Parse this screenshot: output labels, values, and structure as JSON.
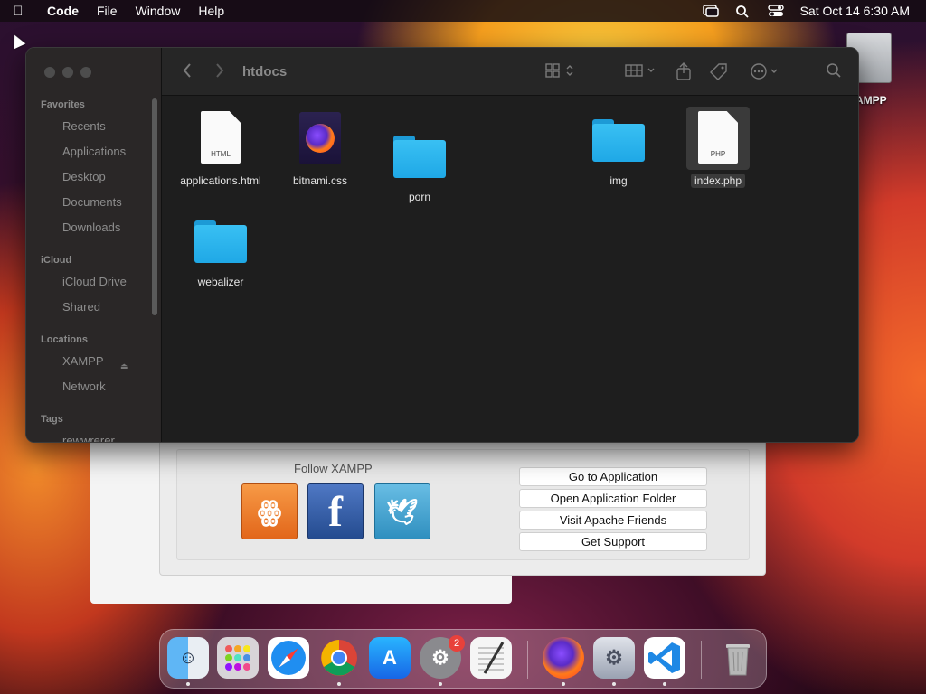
{
  "menubar": {
    "apple_icon": "apple-logo-icon",
    "app_name": "Code",
    "items": [
      "File",
      "Window",
      "Help"
    ],
    "status_icons": [
      "screen-mirroring-icon",
      "search-icon",
      "control-center-icon"
    ],
    "clock": "Sat Oct 14  6:30 AM"
  },
  "desktop": {
    "disk_label": "XAMPP"
  },
  "finder": {
    "title": "htdocs",
    "sidebar": {
      "favorites_heading": "Favorites",
      "favorites": [
        "Recents",
        "Applications",
        "Desktop",
        "Documents",
        "Downloads"
      ],
      "icloud_heading": "iCloud",
      "icloud": [
        "iCloud Drive",
        "Shared"
      ],
      "locations_heading": "Locations",
      "locations": [
        "XAMPP",
        "Network"
      ],
      "tags_heading": "Tags",
      "tags": [
        "rewwrerer"
      ]
    },
    "files": [
      {
        "name": "applications.html",
        "kind": "html-document",
        "tag": "HTML"
      },
      {
        "name": "bitnami.css",
        "kind": "firefox-document"
      },
      {
        "name": "porn",
        "kind": "folder"
      },
      {
        "name": "img",
        "kind": "folder"
      },
      {
        "name": "index.php",
        "kind": "php-document",
        "tag": "PHP",
        "selected": true
      },
      {
        "name": "webalizer",
        "kind": "folder"
      }
    ]
  },
  "xampp": {
    "follow_label": "Follow  XAMPP",
    "buttons": {
      "go_to_application": "Go to Application",
      "open_application_folder": "Open Application Folder",
      "visit_apache_friends": "Visit Apache Friends",
      "get_support": "Get Support"
    }
  },
  "dock": {
    "apps": [
      "Finder",
      "Launchpad",
      "Safari",
      "Chrome",
      "App Store",
      "System Settings",
      "TextEdit",
      "Firefox",
      "System Preferences",
      "Visual Studio Code",
      "Trash"
    ],
    "settings_badge": "2"
  }
}
